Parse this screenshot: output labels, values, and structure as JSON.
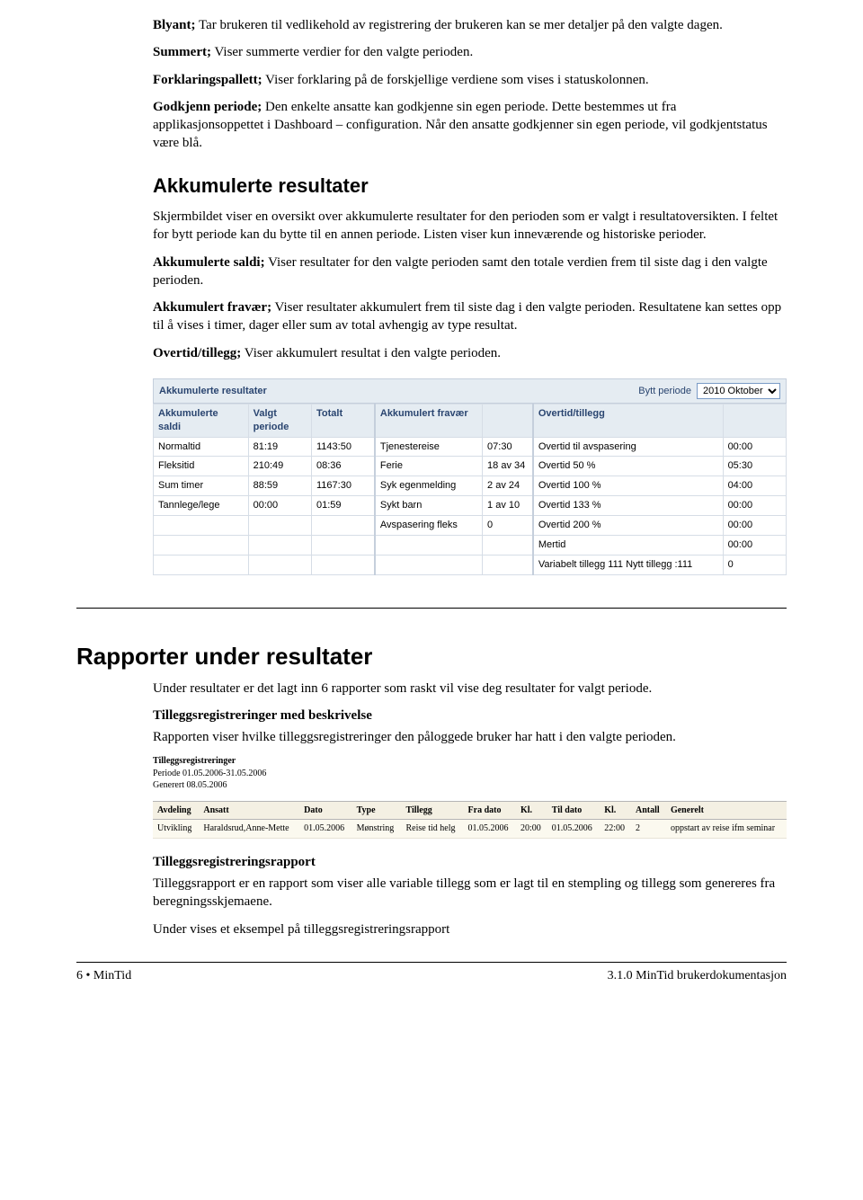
{
  "intro": {
    "p1a": "Blyant;",
    "p1b": " Tar brukeren til vedlikehold av registrering der brukeren kan se mer detaljer på den valgte dagen.",
    "p2a": "Summert;",
    "p2b": " Viser summerte verdier for den valgte perioden.",
    "p3a": "Forklaringspallett;",
    "p3b": " Viser forklaring på de forskjellige verdiene som vises i statuskolonnen.",
    "p4a": "Godkjenn periode;",
    "p4b": " Den enkelte ansatte kan godkjenne sin egen periode. Dette bestemmes ut fra applikasjonsoppettet i Dashboard – configuration. Når den ansatte godkjenner sin egen periode, vil godkjentstatus være blå."
  },
  "akk": {
    "heading": "Akkumulerte resultater",
    "p1": "Skjermbildet viser en oversikt over akkumulerte resultater for den perioden som er valgt i resultatoversikten. I feltet for bytt periode kan du bytte til en annen periode. Listen viser kun inneværende og historiske perioder.",
    "p2a": "Akkumulerte saldi;",
    "p2b": " Viser resultater for den valgte perioden samt den totale verdien frem til siste dag i den valgte perioden.",
    "p3a": "Akkumulert fravær;",
    "p3b": " Viser resultater akkumulert frem til siste dag i den valgte perioden. Resultatene kan settes opp til å vises i timer, dager eller sum av total avhengig av type resultat.",
    "p4a": "Overtid/tillegg;",
    "p4b": " Viser akkumulert resultat i den valgte perioden."
  },
  "akk_embed": {
    "title": "Akkumulerte resultater",
    "bytt_label": "Bytt periode",
    "bytt_value": "2010 Oktober",
    "columns": {
      "saldi": "Akkumulerte saldi",
      "valgt": "Valgt periode",
      "totalt": "Totalt",
      "fravaer": "Akkumulert fravær",
      "fravaer_val": "",
      "overtid": "Overtid/tillegg",
      "overtid_val": ""
    },
    "rows": [
      {
        "c0": "Normaltid",
        "c1": "81:19",
        "c2": "1143:50",
        "c3": "Tjenestereise",
        "c4": "07:30",
        "c5": "Overtid til avspasering",
        "c6": "00:00"
      },
      {
        "c0": "Fleksitid",
        "c1": "210:49",
        "c2": "08:36",
        "c3": "Ferie",
        "c4": "18 av 34",
        "c5": "Overtid 50 %",
        "c6": "05:30"
      },
      {
        "c0": "Sum timer",
        "c1": "88:59",
        "c2": "1167:30",
        "c3": "Syk egenmelding",
        "c4": "2 av 24",
        "c5": "Overtid 100 %",
        "c6": "04:00"
      },
      {
        "c0": "Tannlege/lege",
        "c1": "00:00",
        "c2": "01:59",
        "c3": "Sykt barn",
        "c4": "1 av 10",
        "c5": "Overtid 133 %",
        "c6": "00:00"
      },
      {
        "c0": "",
        "c1": "",
        "c2": "",
        "c3": "Avspasering fleks",
        "c4": "0",
        "c5": "Overtid 200 %",
        "c6": "00:00"
      },
      {
        "c0": "",
        "c1": "",
        "c2": "",
        "c3": "",
        "c4": "",
        "c5": "Mertid",
        "c6": "00:00"
      },
      {
        "c0": "",
        "c1": "",
        "c2": "",
        "c3": "",
        "c4": "",
        "c5": "Variabelt tillegg 111 Nytt tillegg :111",
        "c6": "0"
      }
    ]
  },
  "rapp": {
    "heading": "Rapporter under resultater",
    "p1": "Under resultater er det lagt inn 6 rapporter som raskt vil vise deg resultater for valgt periode.",
    "h1": "Tilleggsregistreringer med beskrivelse",
    "p2": "Rapporten viser hvilke tilleggsregistreringer den påloggede bruker har hatt i den valgte perioden.",
    "h2": "Tilleggsregistreringsrapport",
    "p3": "Tilleggsrapport er en rapport som viser alle variable tillegg som er lagt til en stempling og tillegg som genereres fra beregningsskjemaene.",
    "p4": "Under vises et eksempel på tilleggsregistreringsrapport"
  },
  "rep_embed": {
    "meta": {
      "l1": "Tilleggsregistreringer",
      "l2": "Periode 01.05.2006-31.05.2006",
      "l3": "Generert 08.05.2006"
    },
    "cols": [
      "Avdeling",
      "Ansatt",
      "Dato",
      "Type",
      "Tillegg",
      "Fra dato",
      "Kl.",
      "Til dato",
      "Kl.",
      "Antall",
      "Generelt"
    ],
    "row": [
      "Utvikling",
      "Haraldsrud,Anne-Mette",
      "01.05.2006",
      "Mønstring",
      "Reise tid helg",
      "01.05.2006",
      "20:00",
      "01.05.2006",
      "22:00",
      "2",
      "oppstart av reise ifm seminar"
    ]
  },
  "footer": {
    "left": "6  •  MinTid",
    "right": "3.1.0 MinTid brukerdokumentasjon"
  }
}
